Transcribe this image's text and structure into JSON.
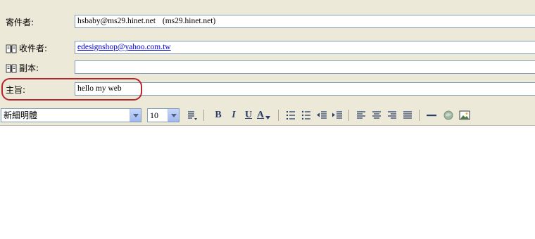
{
  "compose": {
    "from": {
      "label": "寄件者:",
      "value": "hsbaby@ms29.hinet.net",
      "value_alt": "(ms29.hinet.net)"
    },
    "to": {
      "label": "收件者:",
      "value": "edesignshop@yahoo.com.tw"
    },
    "cc": {
      "label": "副本:",
      "value": ""
    },
    "subject": {
      "label": "主旨:",
      "value": "hello my web"
    }
  },
  "toolbar": {
    "font_name": "新細明體",
    "font_size": "10",
    "bold_label": "B",
    "italic_label": "I",
    "underline_label": "U",
    "font_color_label": "A"
  },
  "icons": [
    "address-book-icon",
    "paragraph-style-icon",
    "font-color-icon",
    "numbered-list-icon",
    "bulleted-list-icon",
    "decrease-indent-icon",
    "increase-indent-icon",
    "align-left-icon",
    "align-center-icon",
    "align-right-icon",
    "justify-icon",
    "horizontal-line-icon",
    "insert-link-icon",
    "insert-picture-icon"
  ],
  "colors": {
    "highlight": "#b5262b",
    "link": "#0000cc",
    "chrome": "#ece9d8"
  }
}
